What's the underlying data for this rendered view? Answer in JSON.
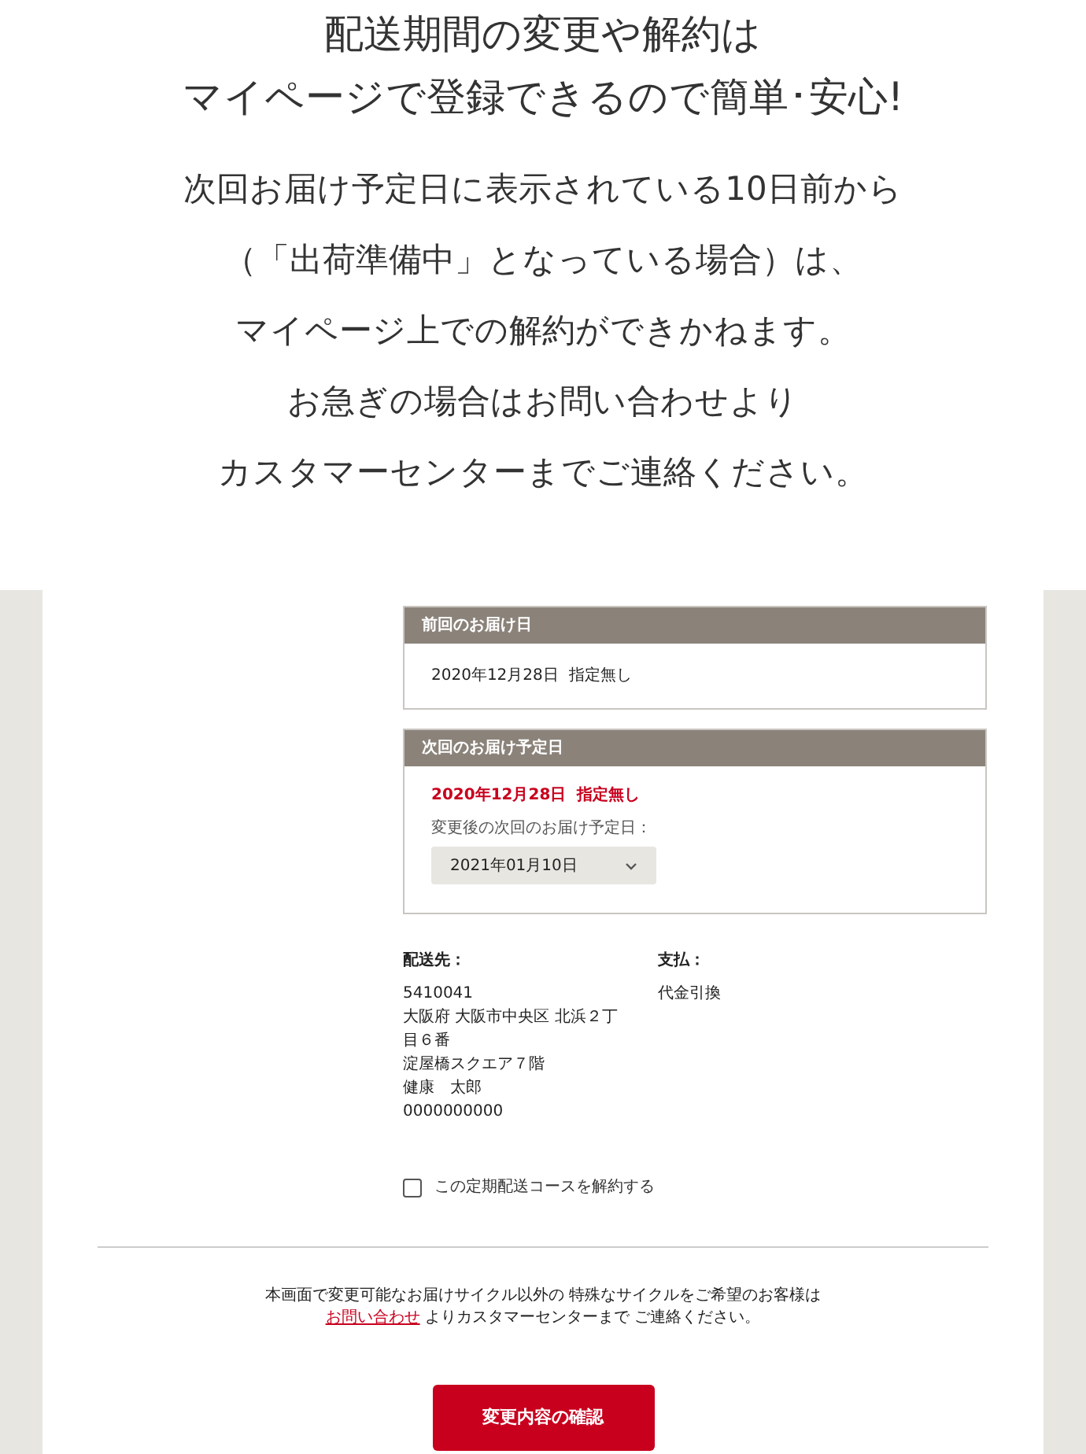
{
  "headline": [
    "配送期間の変更や解約は",
    "マイページで登録できるので簡単･安心!"
  ],
  "notice": [
    "次回お届け予定日に表示されている10日前から",
    "（「出荷準備中」となっている場合）は、",
    "マイページ上での解約ができかねます。",
    "お急ぎの場合はお問い合わせより",
    "カスタマーセンターまでご連絡ください。"
  ],
  "previous_delivery": {
    "title": "前回のお届け日",
    "value": "2020年12月28日  指定無し"
  },
  "next_delivery": {
    "title": "次回のお届け予定日",
    "value": "2020年12月28日  指定無し",
    "change_label": "変更後の次回のお届け予定日：",
    "select_value": "2021年01月10日"
  },
  "shipping": {
    "label": "配送先：",
    "lines": [
      "5410041",
      "大阪府 大阪市中央区 北浜２丁目６番",
      "淀屋橋スクエア７階",
      "健康　太郎",
      "0000000000"
    ]
  },
  "payment": {
    "label": "支払：",
    "value": "代金引換"
  },
  "cancel_checkbox": {
    "label": "この定期配送コースを解約する",
    "checked": false
  },
  "note": {
    "before": "本画面で変更可能なお届けサイクル以外の 特殊なサイクルをご希望のお客様は",
    "link": "お問い合わせ",
    "after": "よりカスタマーセンターまで ご連絡ください。"
  },
  "confirm_button": "変更内容の確認"
}
